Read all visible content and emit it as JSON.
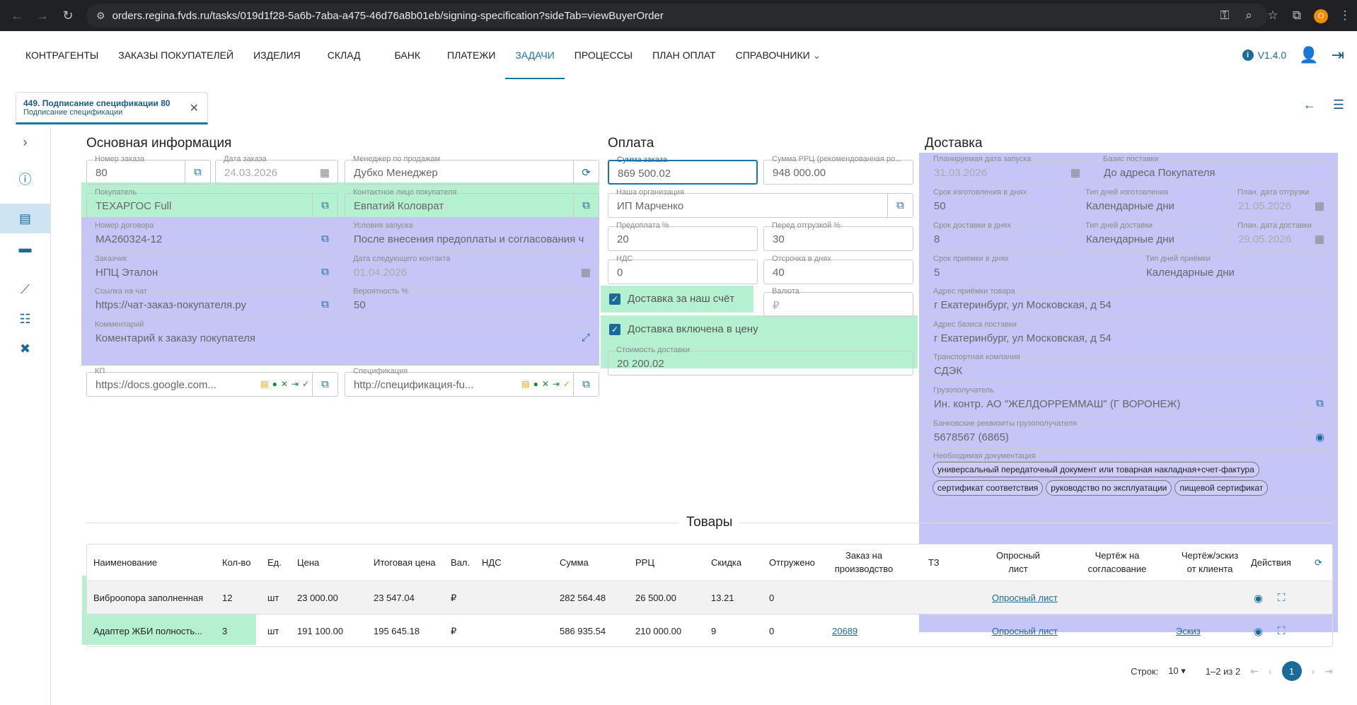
{
  "browser": {
    "url": "orders.regina.fvds.ru/tasks/019d1f28-5a6b-7aba-a475-46d76a8b01eb/signing-specification?sideTab=viewBuyerOrder",
    "profile_initial": "O"
  },
  "nav": {
    "items": [
      "Контрагенты",
      "Заказы покупателей",
      "Изделия",
      "Склад",
      "Банк",
      "Платежи",
      "Задачи",
      "Процессы",
      "План оплат",
      "Справочники"
    ],
    "active": "Задачи",
    "version": "V1.4.0"
  },
  "tab": {
    "title": "449. Подписание спецификации 80",
    "subtitle": "Подписание спецификации"
  },
  "main": {
    "title": "Основная информация",
    "order_number_label": "Номер заказа",
    "order_number": "80",
    "order_date_label": "Дата заказа",
    "order_date": "24.03.2026",
    "manager_label": "Менеджер по продажам",
    "manager": "Дубко Менеджер",
    "buyer_label": "Покупатель",
    "buyer": "ТЕХАРГОС Full",
    "contact_label": "Контактное лицо покупателя",
    "contact": "Евпатий Коловрат",
    "contract_label": "Номер договора",
    "contract": "МА260324-12",
    "launch_cond_label": "Условия запуска",
    "launch_cond": "После внесения предоплаты и согласования ч",
    "customer_label": "Заказчик",
    "customer": "НПЦ Эталон",
    "next_contact_label": "Дата следующего контакта",
    "next_contact": "01.04.2026",
    "chat_label": "Ссылка на чат",
    "chat": "https://чат-заказ-покупателя.ру",
    "probability_label": "Вероятность %",
    "probability": "50",
    "comment_label": "Комментарий",
    "comment": "Коментарий к заказу покупателя",
    "kp_label": "КП",
    "kp": "https://docs.google.com...",
    "spec_label": "Спецификация",
    "spec": "http://спецификация-fu..."
  },
  "payment": {
    "title": "Оплата",
    "sum_label": "Сумма заказа",
    "sum": "869 500.02",
    "rrp_label": "Сумма РРЦ (рекомендованная ро...",
    "rrp": "948 000.00",
    "org_label": "Наша организация",
    "org": "ИП Марченко",
    "prepay_label": "Предоплата %",
    "prepay": "20",
    "before_ship_label": "Перед отгрузкой %",
    "before_ship": "30",
    "vat_label": "НДС",
    "vat": "0",
    "delay_label": "Отсрочка в днях",
    "delay": "40",
    "delivery_ours": "Доставка за наш счёт",
    "currency_label": "Валюта",
    "currency": "₽",
    "delivery_included": "Доставка включена в цену",
    "delivery_cost_label": "Стоимость доставки",
    "delivery_cost": "20 200.02"
  },
  "delivery": {
    "title": "Доставка",
    "launch_date_label": "Планируемая дата запуска",
    "launch_date": "31.03.2026",
    "basis_label": "Базис поставки",
    "basis": "До адреса Покупателя",
    "prod_days_label": "Срок изготовления в днях",
    "prod_days": "50",
    "prod_type_label": "Тип дней изготовления",
    "prod_type": "Календарные дни",
    "ship_date_label": "План. дата отгрузки",
    "ship_date": "21.05.2026",
    "del_days_label": "Срок доставки в днях",
    "del_days": "8",
    "del_type_label": "Тип дней доставки",
    "del_type": "Календарные дни",
    "del_date_label": "План. дата доставки",
    "del_date": "29.05.2026",
    "accept_days_label": "Срок приёмки в днях",
    "accept_days": "5",
    "accept_type_label": "Тип дней приёмки",
    "accept_type": "Календарные дни",
    "accept_addr_label": "Адрес приёмки товара",
    "accept_addr": "г Екатеринбург, ул Московская, д 54",
    "basis_addr_label": "Адрес базиса поставки",
    "basis_addr": "г Екатеринбург, ул Московская, д 54",
    "transport_label": "Транспортная компания",
    "transport": "СДЭК",
    "consignee_label": "Грузополучатель",
    "consignee": "Ин. контр. АО \"ЖЕЛДОРРЕММАШ\" (Г ВОРОНЕЖ)",
    "bank_label": "Банковские реквизиты грузополучателя",
    "bank": "5678567 (6865)",
    "docs_label": "Необходимая документация",
    "docs": [
      "универсальный передаточный документ или товарная накладная+счет-фактура",
      "сертификат соответствия",
      "руководство по эксплуатации",
      "пищевой сертификат"
    ]
  },
  "goods": {
    "title": "Товары",
    "headers": [
      "Наименование",
      "Кол-во",
      "Ед.",
      "Цена",
      "Итоговая цена",
      "Вал.",
      "НДС",
      "Сумма",
      "РРЦ",
      "Скидка",
      "Отгружено",
      "Заказ на производство",
      "ТЗ",
      "Опросный лист",
      "Чертёж на согласование",
      "Чертёж/эскиз от клиента",
      "Действия"
    ],
    "rows": [
      {
        "name": "Виброопора заполненная",
        "qty": "12",
        "unit": "шт",
        "price": "23 000.00",
        "total_price": "23 547.04",
        "cur": "₽",
        "vat": "",
        "sum": "282 564.48",
        "rrp": "26 500.00",
        "discount": "13.21",
        "shipped": "0",
        "prod_order": "",
        "tz": "",
        "survey": "Опросный лист",
        "drawing": "",
        "sketch": ""
      },
      {
        "name": "Адаптер ЖБИ полность...",
        "qty": "3",
        "unit": "шт",
        "price": "191 100.00",
        "total_price": "195 645.18",
        "cur": "₽",
        "vat": "",
        "sum": "586 935.54",
        "rrp": "210 000.00",
        "discount": "9",
        "shipped": "0",
        "prod_order": "20689",
        "tz": "",
        "survey": "Опросный лист",
        "drawing": "",
        "sketch": "Эскиз"
      }
    ],
    "rows_label": "Строк:",
    "rows_per_page": "10",
    "range": "1–2 из 2",
    "page": "1"
  }
}
